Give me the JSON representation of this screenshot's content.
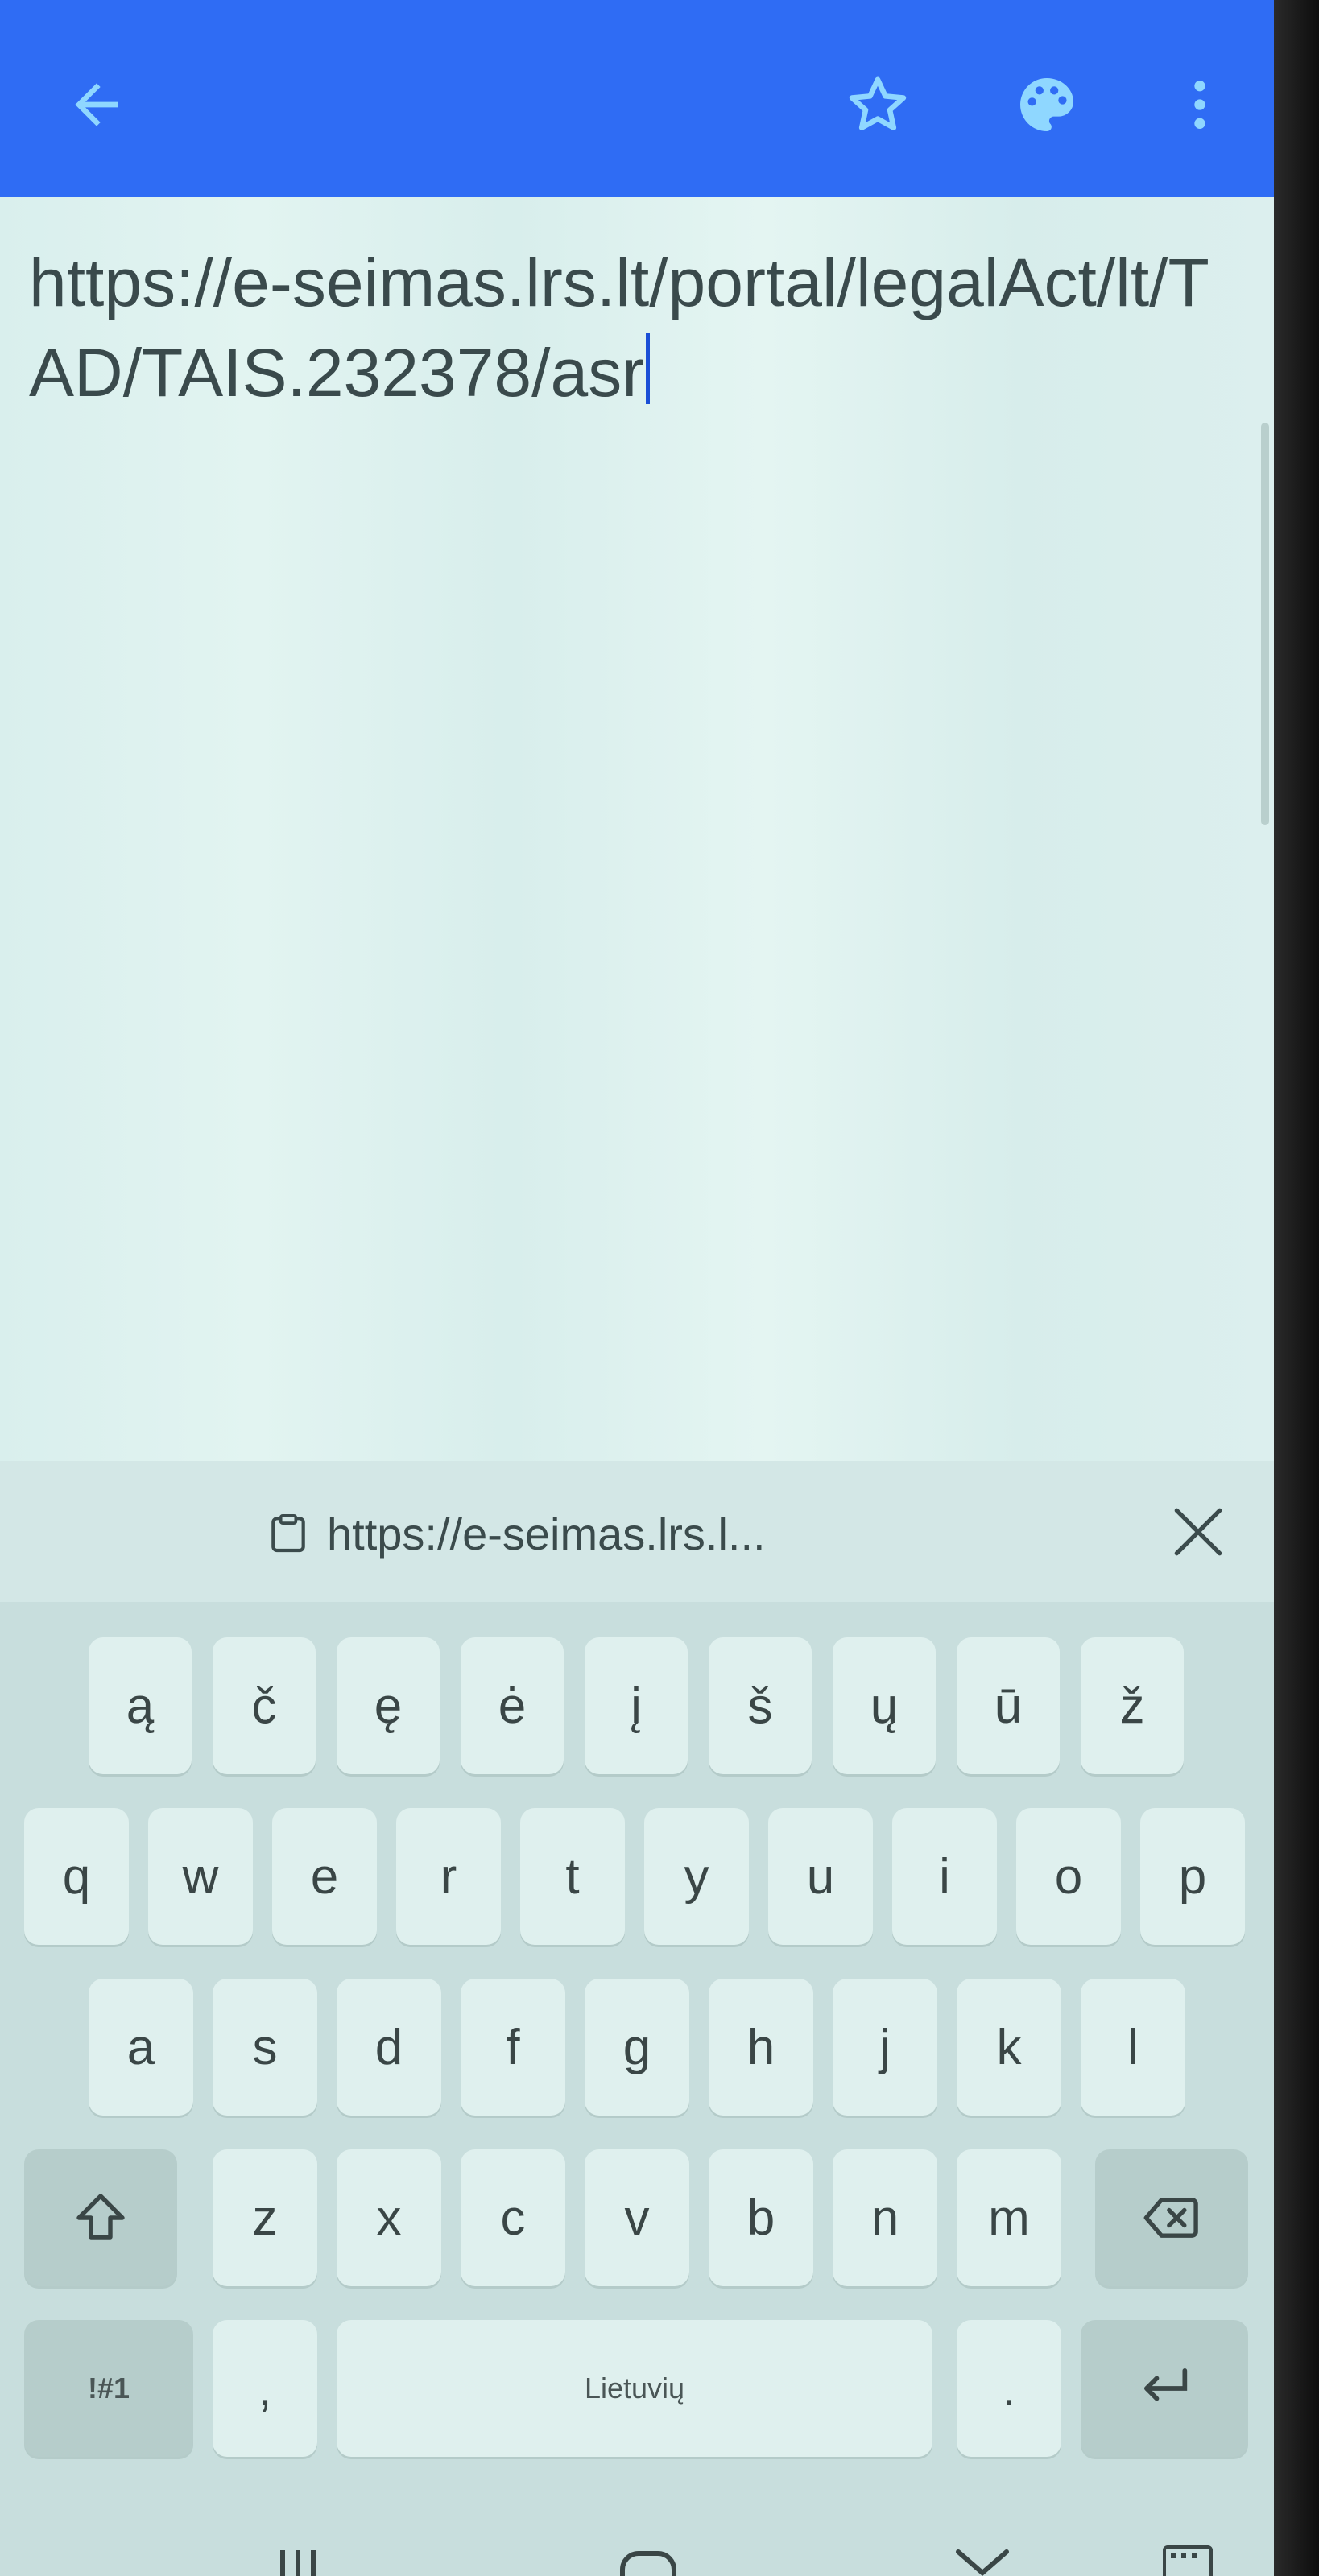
{
  "appbar": {
    "back_icon": "arrow-left-icon",
    "star_icon": "star-outline-icon",
    "palette_icon": "palette-icon",
    "menu_icon": "more-vert-icon",
    "color": "#2f6cf4"
  },
  "editor": {
    "text": "https://e-seimas.lrs.lt/portal/legalAct/lt/TAD/TAIS.232378/asr"
  },
  "clipboard": {
    "suggestion": "https://e-seimas.lrs.l...",
    "clipboard_icon": "clipboard-icon",
    "close_icon": "close-icon"
  },
  "keyboard": {
    "row_lt": [
      "ą",
      "č",
      "ę",
      "ė",
      "į",
      "š",
      "ų",
      "ū",
      "ž"
    ],
    "row1": [
      "q",
      "w",
      "e",
      "r",
      "t",
      "y",
      "u",
      "i",
      "o",
      "p"
    ],
    "row2": [
      "a",
      "s",
      "d",
      "f",
      "g",
      "h",
      "j",
      "k",
      "l"
    ],
    "row3": [
      "z",
      "x",
      "c",
      "v",
      "b",
      "n",
      "m"
    ],
    "shift_icon": "shift-icon",
    "backspace_icon": "backspace-icon",
    "symbols_label": "!#1",
    "comma_label": ",",
    "space_label": "Lietuvių",
    "period_label": ".",
    "enter_icon": "enter-icon"
  }
}
